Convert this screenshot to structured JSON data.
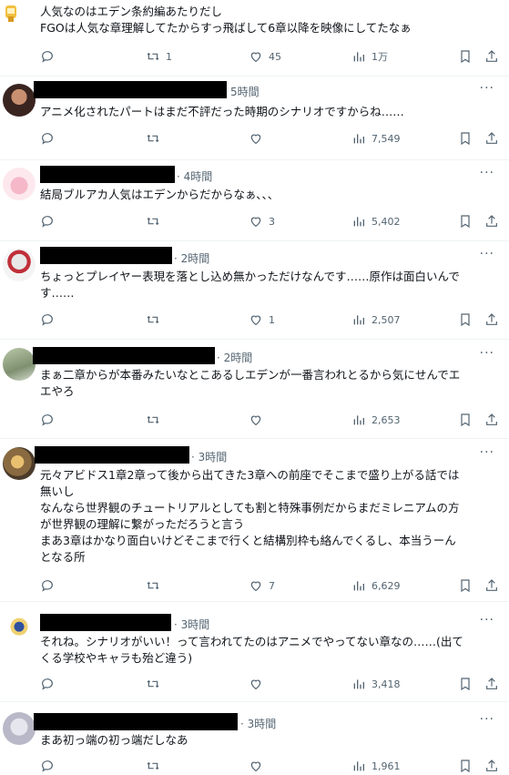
{
  "posts": [
    {
      "time": "",
      "text_lines": [
        "人気なのはエデン条約編あたりだし",
        "FGOは人気な章理解してたからすっ飛ばして6章以降を映像にしてたなぁ"
      ],
      "reply": "",
      "retweet": "1",
      "like": "45",
      "views": "1万"
    },
    {
      "time": "5時間",
      "text_lines": [
        "アニメ化されたパートはまだ不評だった時期のシナリオですからね……"
      ],
      "reply": "",
      "retweet": "",
      "like": "",
      "views": "7,549"
    },
    {
      "time": "· 4時間",
      "text_lines": [
        "結局ブルアカ人気はエデンからだからなぁ、、、"
      ],
      "reply": "",
      "retweet": "",
      "like": "3",
      "views": "5,402"
    },
    {
      "time": "· 2時間",
      "text_lines": [
        "ちょっとプレイヤー表現を落とし込め無かっただけなんです……原作は面白いんで",
        "す……"
      ],
      "reply": "",
      "retweet": "",
      "like": "1",
      "views": "2,507"
    },
    {
      "time": "· 2時間",
      "text_lines": [
        "まぁ二章からが本番みたいなとこあるしエデンが一番言われとるから気にせんでエ",
        "エやろ"
      ],
      "reply": "",
      "retweet": "",
      "like": "",
      "views": "2,653"
    },
    {
      "time": "· 3時間",
      "text_lines": [
        "元々アビドス1章2章って後から出てきた3章への前座でそこまで盛り上がる話では",
        "無いし",
        "なんなら世界観のチュートリアルとしても割と特殊事例だからまだミレニアムの方",
        "が世界観の理解に繋がっただろうと言う",
        "まあ3章はかなり面白いけどそこまで行くと結構別枠も絡んでくるし、本当うーん",
        "となる所"
      ],
      "reply": "",
      "retweet": "",
      "like": "7",
      "views": "6,629"
    },
    {
      "time": "· 3時間",
      "text_lines": [
        "それね。シナリオがいい！って言われてたのはアニメでやってない章なの……(出て",
        "くる学校やキャラも殆ど違う)"
      ],
      "reply": "",
      "retweet": "",
      "like": "",
      "views": "3,418"
    },
    {
      "time": "· 3時間",
      "text_lines": [
        "まあ初っ端の初っ端だしなあ"
      ],
      "reply": "",
      "retweet": "",
      "like": "",
      "views": "1,961"
    }
  ],
  "icons": {
    "reply": "reply-icon",
    "retweet": "retweet-icon",
    "like": "heart-icon",
    "views": "views-icon",
    "bookmark": "bookmark-icon",
    "share": "share-icon",
    "more": "more-icon"
  },
  "more_glyph": "···",
  "colors": {
    "text": "#0f1419",
    "muted": "#536471",
    "divider": "#eff3f4"
  }
}
